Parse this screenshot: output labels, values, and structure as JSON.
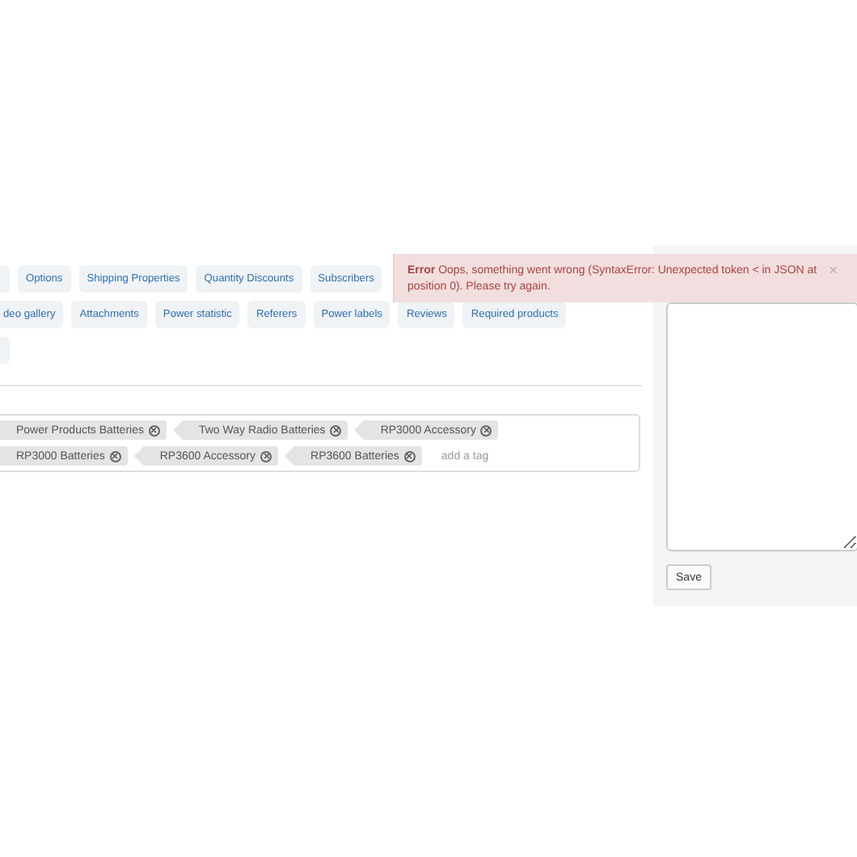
{
  "tabs": [
    [
      {
        "kind": "stub"
      },
      {
        "kind": "tab",
        "label": "Options"
      },
      {
        "kind": "tab",
        "label": "Shipping Properties"
      },
      {
        "kind": "tab",
        "label": "Quantity Discounts"
      },
      {
        "kind": "tab",
        "label": "Subscribers"
      }
    ],
    [
      {
        "kind": "tab",
        "label": "deo gallery"
      },
      {
        "kind": "tab",
        "label": "Attachments"
      },
      {
        "kind": "tab",
        "label": "Power statistic"
      },
      {
        "kind": "tab",
        "label": "Referers"
      },
      {
        "kind": "tab",
        "label": "Power labels"
      },
      {
        "kind": "tab",
        "label": "Reviews"
      },
      {
        "kind": "tab",
        "label": "Required products"
      }
    ],
    [
      {
        "kind": "stub"
      }
    ]
  ],
  "tags": {
    "items": [
      "Power Products Batteries",
      "Two Way Radio Batteries",
      "RP3000 Accessory",
      "RP3000 Batteries",
      "RP3600 Accessory",
      "RP3600 Batteries"
    ],
    "placeholder": "add a tag"
  },
  "sidebar": {
    "button": "Save"
  },
  "alert": {
    "title": "Error",
    "message": "Oops, something went wrong (SyntaxError: Unexpected token < in JSON at position 0). Please try again.",
    "close": "×"
  }
}
